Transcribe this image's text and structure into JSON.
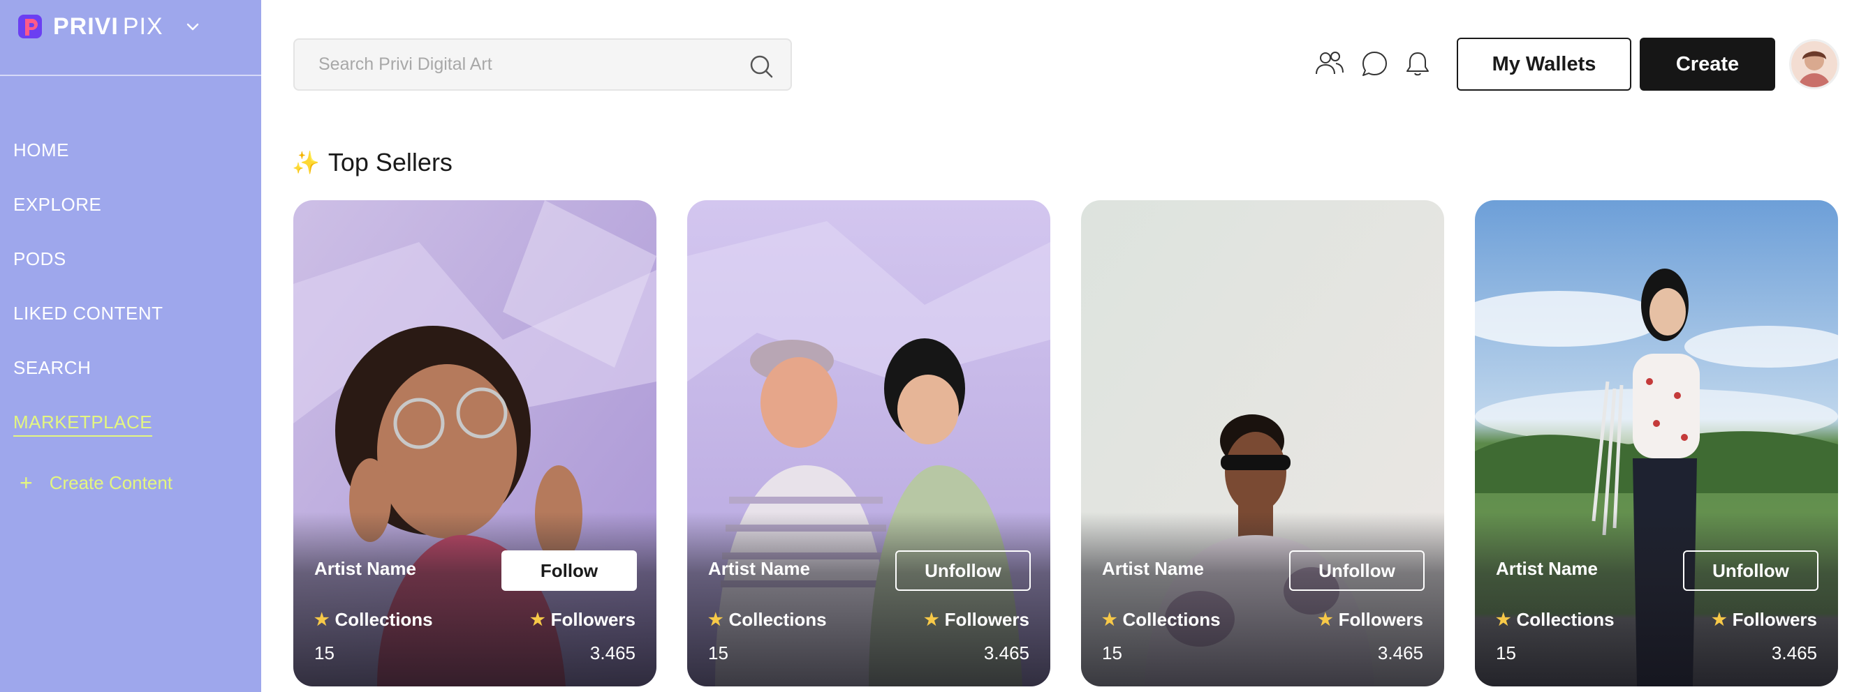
{
  "app": {
    "logo_bold": "PRIVI",
    "logo_light": "PIX"
  },
  "sidebar": {
    "items": [
      {
        "label": "HOME"
      },
      {
        "label": "EXPLORE"
      },
      {
        "label": "PODS"
      },
      {
        "label": "LIKED CONTENT"
      },
      {
        "label": "SEARCH"
      },
      {
        "label": "MARKETPLACE",
        "active": true
      }
    ],
    "create_label": "Create Content"
  },
  "header": {
    "search_placeholder": "Search Privi Digital Art",
    "wallets_label": "My Wallets",
    "create_label": "Create",
    "icons": [
      "users-icon",
      "chat-icon",
      "bell-icon",
      "search-icon"
    ]
  },
  "section": {
    "title": "Top Sellers"
  },
  "cards": [
    {
      "artist": "Artist Name",
      "action": "Follow",
      "collections_label": "Collections",
      "followers_label": "Followers",
      "collections": "15",
      "followers": "3.465"
    },
    {
      "artist": "Artist Name",
      "action": "Unfollow",
      "collections_label": "Collections",
      "followers_label": "Followers",
      "collections": "15",
      "followers": "3.465"
    },
    {
      "artist": "Artist Name",
      "action": "Unfollow",
      "collections_label": "Collections",
      "followers_label": "Followers",
      "collections": "15",
      "followers": "3.465"
    },
    {
      "artist": "Artist Name",
      "action": "Unfollow",
      "collections_label": "Collections",
      "followers_label": "Followers",
      "collections": "15",
      "followers": "3.465"
    }
  ],
  "colors": {
    "sidebar_bg": "#9ea7ec",
    "accent": "#e4f680",
    "primary_dark": "#161616"
  }
}
